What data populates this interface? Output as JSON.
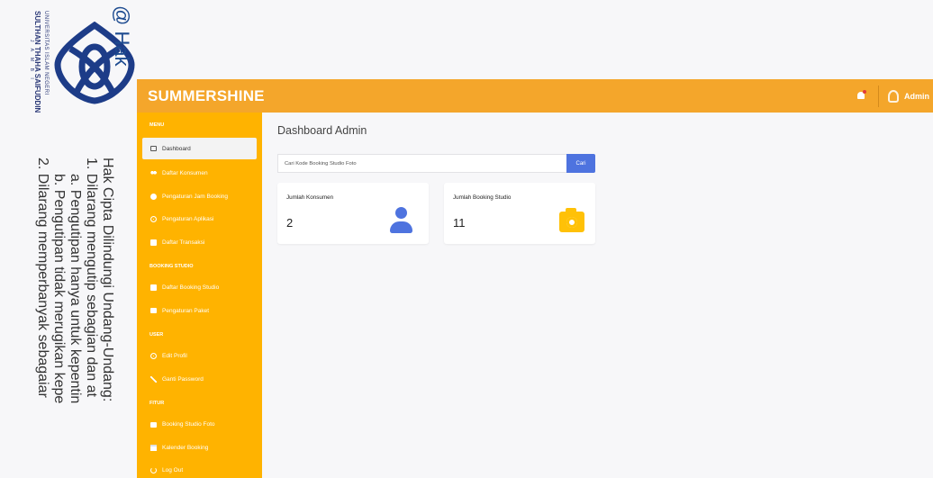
{
  "watermark": {
    "university_line1": "UNIVERSITAS ISLAM NEGERI",
    "university_line2": "SULTHAN THAHA SAIFUDDIN",
    "university_line3": "J A M B I",
    "hak_text": "@ Hak",
    "copyright_lines": [
      "Hak Cipta Dilindungi Undang-Undang:",
      "1. Dilarang mengutip sebagian dan at",
      "a. Pengutipan hanya untuk kepentin",
      "b. Pengutipan tidak merugikan kepe",
      "2. Dilarang memperbanyak sebagaiar"
    ]
  },
  "topbar": {
    "brand": "SUMMERSHINE",
    "user_name": "Admin",
    "colors": {
      "bar": "#f4a62b",
      "sidebar": "#ffb300",
      "primary": "#4e73df"
    }
  },
  "sidebar": {
    "sections": [
      {
        "heading": "MENU",
        "items": [
          {
            "label": "Dashboard",
            "icon": "monitor-icon",
            "active": true
          },
          {
            "label": "Daftar Konsumen",
            "icon": "users-icon"
          },
          {
            "label": "Pengaturan Jam Booking",
            "icon": "clock-icon"
          },
          {
            "label": "Pengaturan Aplikasi",
            "icon": "gear-icon"
          },
          {
            "label": "Daftar Transaksi",
            "icon": "book-icon"
          }
        ]
      },
      {
        "heading": "BOOKING STUDIO",
        "items": [
          {
            "label": "Daftar Booking Studio",
            "icon": "book-icon"
          },
          {
            "label": "Pengaturan Paket",
            "icon": "tv-icon"
          }
        ]
      },
      {
        "heading": "USER",
        "items": [
          {
            "label": "Edit Profil",
            "icon": "gear-icon"
          },
          {
            "label": "Ganti Password",
            "icon": "key-icon"
          }
        ]
      },
      {
        "heading": "FITUR",
        "items": [
          {
            "label": "Booking Studio Foto",
            "icon": "tv-icon"
          },
          {
            "label": "Kalender Booking",
            "icon": "calendar-icon"
          },
          {
            "label": "Log Out",
            "icon": "power-icon"
          }
        ]
      }
    ]
  },
  "main": {
    "title": "Dashboard Admin",
    "search": {
      "placeholder": "Cari Kode Booking Studio Foto",
      "button": "Cari"
    },
    "cards": [
      {
        "label": "Jumlah Konsumen",
        "value": "2",
        "icon": "person-icon"
      },
      {
        "label": "Jumlah Booking Studio",
        "value": "11",
        "icon": "camera-icon"
      }
    ]
  }
}
